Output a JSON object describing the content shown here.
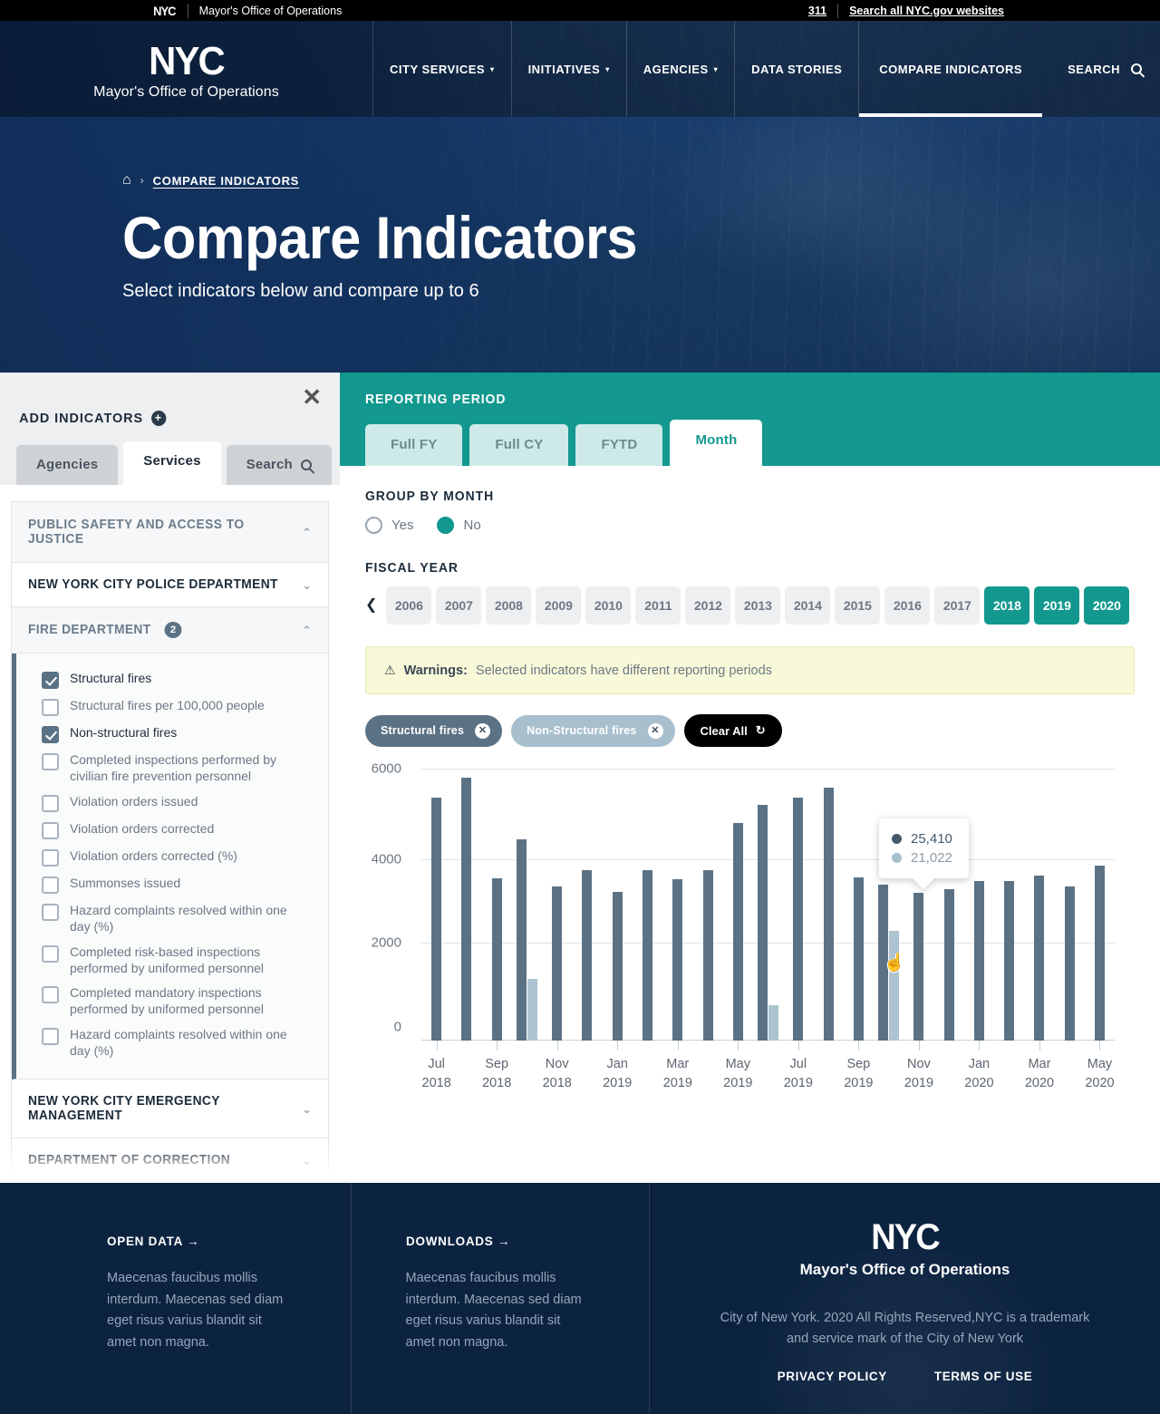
{
  "utility_bar": {
    "logo": "NYC",
    "title": "Mayor's Office of Operations",
    "phone": "311",
    "search_all": "Search all NYC.gov websites"
  },
  "header": {
    "logo": "NYC",
    "logo_sub": "Mayor's Office of Operations",
    "nav": [
      {
        "label": "CITY SERVICES",
        "caret": "▾",
        "active": false
      },
      {
        "label": "INITIATIVES",
        "caret": "▾",
        "active": false
      },
      {
        "label": "AGENCIES",
        "caret": "▾",
        "active": false
      },
      {
        "label": "DATA STORIES",
        "caret": "",
        "active": false
      },
      {
        "label": "COMPARE INDICATORS",
        "caret": "",
        "active": true
      }
    ],
    "search_label": "SEARCH"
  },
  "hero": {
    "breadcrumb_home": "⌂",
    "breadcrumb_sep": "›",
    "breadcrumb_current": "COMPARE INDICATORS",
    "title": "Compare Indicators",
    "subtitle": "Select indicators below and compare up to 6"
  },
  "sidebar": {
    "close_label": "✕",
    "title": "ADD INDICATORS",
    "plus": "+",
    "tabs": [
      {
        "label": "Agencies",
        "active": false
      },
      {
        "label": "Services",
        "active": true
      },
      {
        "label": "Search",
        "active": false,
        "icon": "search-icon"
      }
    ],
    "section": {
      "label": "PUBLIC SAFETY AND ACCESS TO JUSTICE",
      "chevron": "⌃"
    },
    "agencies": [
      {
        "label": "NEW YORK CITY POLICE DEPARTMENT",
        "chevron": "⌄",
        "open": false,
        "count": null
      },
      {
        "label": "FIRE DEPARTMENT",
        "chevron": "⌃",
        "open": true,
        "count": "2"
      },
      {
        "label": "NEW YORK CITY EMERGENCY MANAGEMENT",
        "chevron": "⌄",
        "open": false,
        "count": null
      },
      {
        "label": "DEPARTMENT OF CORRECTION",
        "chevron": "⌄",
        "open": false,
        "count": null
      }
    ],
    "indicators": [
      {
        "label": "Structural fires",
        "checked": true
      },
      {
        "label": "Structural fires per 100,000 people",
        "checked": false
      },
      {
        "label": "Non-structural fires",
        "checked": true
      },
      {
        "label": "Completed inspections performed by civilian fire prevention personnel",
        "checked": false
      },
      {
        "label": "Violation orders issued",
        "checked": false
      },
      {
        "label": "Violation orders corrected",
        "checked": false
      },
      {
        "label": "Violation orders corrected (%)",
        "checked": false
      },
      {
        "label": "Summonses issued",
        "checked": false
      },
      {
        "label": "Hazard complaints resolved within one day (%)",
        "checked": false
      },
      {
        "label": "Completed risk-based inspections performed by uniformed personnel",
        "checked": false
      },
      {
        "label": "Completed mandatory inspections performed by uniformed personnel",
        "checked": false
      },
      {
        "label": "Hazard complaints resolved within one day (%)",
        "checked": false
      }
    ]
  },
  "reporting_period": {
    "label": "REPORTING PERIOD",
    "tabs": [
      {
        "label": "Full FY",
        "active": false
      },
      {
        "label": "Full CY",
        "active": false
      },
      {
        "label": "FYTD",
        "active": false
      },
      {
        "label": "Month",
        "active": true
      }
    ]
  },
  "group_by_month": {
    "label": "GROUP BY MONTH",
    "options": [
      {
        "label": "Yes",
        "selected": false
      },
      {
        "label": "No",
        "selected": true
      }
    ]
  },
  "fiscal_year": {
    "label": "FISCAL YEAR",
    "prev_arrow": "❮",
    "years": [
      {
        "year": "2006",
        "selected": false
      },
      {
        "year": "2007",
        "selected": false
      },
      {
        "year": "2008",
        "selected": false
      },
      {
        "year": "2009",
        "selected": false
      },
      {
        "year": "2010",
        "selected": false
      },
      {
        "year": "2011",
        "selected": false
      },
      {
        "year": "2012",
        "selected": false
      },
      {
        "year": "2013",
        "selected": false
      },
      {
        "year": "2014",
        "selected": false
      },
      {
        "year": "2015",
        "selected": false
      },
      {
        "year": "2016",
        "selected": false
      },
      {
        "year": "2017",
        "selected": false
      },
      {
        "year": "2018",
        "selected": true
      },
      {
        "year": "2019",
        "selected": true
      },
      {
        "year": "2020",
        "selected": true
      }
    ]
  },
  "warning": {
    "icon": "⚠",
    "bold": "Warnings:",
    "text": "Selected indicators have different reporting periods"
  },
  "chips": {
    "items": [
      {
        "label": "Structural fires",
        "remove": "✕",
        "color": "#5b7285"
      },
      {
        "label": "Non-Structural fires",
        "remove": "✕",
        "color": "#a8bfcd"
      }
    ],
    "clear_all": "Clear All",
    "clear_icon": "↻"
  },
  "tooltip": {
    "rows": [
      {
        "value": "25,410",
        "color": "#44596b"
      },
      {
        "value": "21,022",
        "color": "#a8bfcd"
      }
    ]
  },
  "chart_data": {
    "type": "bar",
    "title": "",
    "xlabel": "",
    "ylabel": "",
    "ylim": [
      0,
      6000
    ],
    "y_ticks": [
      0,
      2000,
      4000,
      6000
    ],
    "grid": true,
    "legend": [
      "Structural fires",
      "Non-Structural fires"
    ],
    "series_colors": [
      "#5b7285",
      "#adc3d0"
    ],
    "x_tick_labels": [
      {
        "month": "Jul",
        "year": "2018"
      },
      {
        "month": "Sep",
        "year": "2018"
      },
      {
        "month": "Nov",
        "year": "2018"
      },
      {
        "month": "Jan",
        "year": "2019"
      },
      {
        "month": "Mar",
        "year": "2019"
      },
      {
        "month": "May",
        "year": "2019"
      },
      {
        "month": "Jul",
        "year": "2019"
      },
      {
        "month": "Sep",
        "year": "2019"
      },
      {
        "month": "Nov",
        "year": "2019"
      },
      {
        "month": "Jan",
        "year": "2020"
      },
      {
        "month": "Mar",
        "year": "2020"
      },
      {
        "month": "May",
        "year": "2020"
      }
    ],
    "categories": [
      "Jul 2018",
      "Aug 2018",
      "Sep 2018",
      "Oct 2018",
      "Nov 2018",
      "Dec 2018",
      "Jan 2019",
      "Feb 2019",
      "Mar 2019",
      "Apr 2019",
      "May 2019",
      "Jun 2019",
      "Jul 2019",
      "Aug 2019",
      "Sep 2019",
      "Oct 2019",
      "Nov 2019",
      "Dec 2019",
      "Jan 2020",
      "Feb 2020",
      "Mar 2020",
      "Apr 2020",
      "May 2020"
    ],
    "series": [
      {
        "name": "Structural fires",
        "color": "#5b7285",
        "values": [
          5360,
          5800,
          3580,
          4440,
          3400,
          3770,
          3290,
          3770,
          3570,
          3770,
          4810,
          5200,
          5370,
          5580,
          3600,
          3450,
          3270,
          3340,
          3520,
          3530,
          3650,
          3400,
          3860
        ]
      },
      {
        "name": "Non-Structural fires",
        "color": "#adc3d0",
        "values": [
          0,
          0,
          0,
          1360,
          0,
          0,
          0,
          0,
          0,
          0,
          0,
          790,
          0,
          0,
          0,
          2420,
          0,
          0,
          0,
          0,
          0,
          0,
          0
        ]
      }
    ],
    "hover": {
      "category": "Oct 2019",
      "values": [
        "25,410",
        "21,022"
      ]
    }
  },
  "footer": {
    "columns": [
      {
        "heading": "OPEN DATA  →",
        "body": "Maecenas faucibus mollis interdum. Maecenas sed diam eget risus varius blandit sit amet non magna."
      },
      {
        "heading": "DOWNLOADS  →",
        "body": "Maecenas faucibus mollis interdum. Maecenas sed diam eget risus varius blandit sit amet non magna."
      }
    ],
    "logo": "NYC",
    "logo_sub": "Mayor's Office of Operations",
    "copyright": "City of New York. 2020 All Rights Reserved,NYC is a trademark and service mark of the City of New York",
    "links": [
      "PRIVACY POLICY",
      "TERMS OF USE"
    ]
  }
}
